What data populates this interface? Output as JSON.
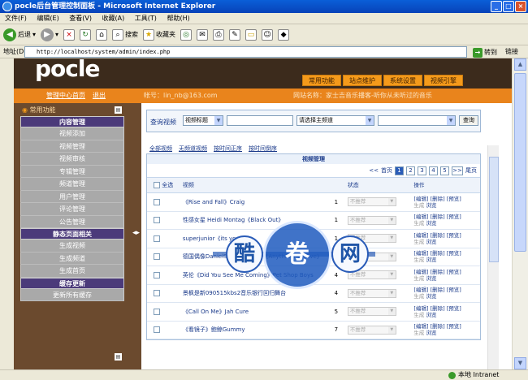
{
  "window": {
    "title": "pocle后台管理控制面板 - Microsoft Internet Explorer"
  },
  "menu": [
    "文件(F)",
    "编辑(E)",
    "查看(V)",
    "收藏(A)",
    "工具(T)",
    "帮助(H)"
  ],
  "toolbar": {
    "back": "后退",
    "search": "搜索",
    "favorites": "收藏夹"
  },
  "address": {
    "label": "地址(D)",
    "url": "http://localhost/system/admin/index.php",
    "go": "转到",
    "links": "链接"
  },
  "header": {
    "logo": "pocle",
    "nav": [
      "常用功能",
      "站点维护",
      "系统设置",
      "视频引擎"
    ],
    "home_link": "管理中心首页",
    "logout": "退出",
    "account": "帐号：lin_nb@163.com",
    "site_name": "网站名称：家士吉音乐播客-听你从未听过的音乐"
  },
  "sidebar": {
    "top": "常用功能",
    "sections": [
      {
        "title": "内容管理",
        "items": [
          "视频添加",
          "视频管理",
          "视频审核",
          "专辑管理",
          "频道管理",
          "用户管理",
          "评论管理",
          "公告管理"
        ]
      },
      {
        "title": "静态页面相关",
        "items": [
          "生成视频",
          "生成频道",
          "生成首页"
        ]
      },
      {
        "title": "缓存更新",
        "items": [
          "更新所有缓存"
        ]
      }
    ]
  },
  "search": {
    "label": "查询视频",
    "field_select": "视频标题",
    "channel_select": "请选择主频道",
    "button": "查询"
  },
  "tabs": [
    "全部视频",
    "无频道视频",
    "按时间正序",
    "按时间倒序"
  ],
  "grid": {
    "title": "视频管理",
    "pager": {
      "first": "首页",
      "prev": "<<",
      "pages": [
        "1",
        "2",
        "3",
        "4",
        "5"
      ],
      "current": "1",
      "next": ">>",
      "last": "尾页"
    },
    "headers": {
      "select_all": "全选",
      "title": "视频",
      "status": "状态",
      "actions": "操作"
    },
    "rows": [
      {
        "title": "《Rise and Fall》Craig",
        "count": "1",
        "status": "不推荐"
      },
      {
        "title": "性感女星 Heidi Montag《Black Out》",
        "count": "1",
        "status": "不推荐"
      },
      {
        "title": "superjunior《its you 》",
        "count": "1",
        "status": "不推荐"
      },
      {
        "title": "德国偶像DanielSchuhmacher《AnythingbutLove》",
        "count": "0",
        "status": "不推荐"
      },
      {
        "title": "英伦《Did You See Me Coming》Pet Shop Boys",
        "count": "4",
        "status": "不推荐"
      },
      {
        "title": "景枫是新090515kbs2音乐银行回归舞台",
        "count": "4",
        "status": "不推荐"
      },
      {
        "title": "《Call On Me》Jah Cure",
        "count": "5",
        "status": "不推荐"
      },
      {
        "title": "《看镜子》鲍鲸Gummy",
        "count": "7",
        "status": "不推荐"
      }
    ],
    "actions": {
      "edit": "[编辑]",
      "delete": "[删除]",
      "preview": "[预览]",
      "sub1": "生成",
      "sub2": "浏览"
    }
  },
  "watermark": [
    "酷",
    "卷",
    "网"
  ],
  "status": {
    "zone": "本地 Intranet"
  }
}
